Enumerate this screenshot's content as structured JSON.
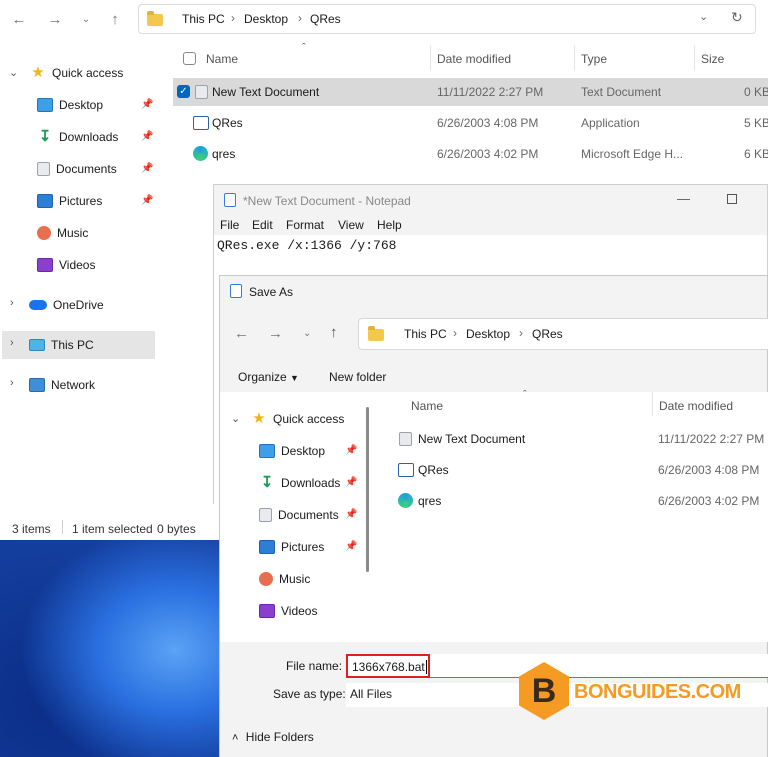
{
  "explorer": {
    "address": [
      "This PC",
      "Desktop",
      "QRes"
    ],
    "sidebar": [
      {
        "label": "Quick access",
        "icon": "star-icon"
      },
      {
        "label": "Desktop",
        "icon": "desktop-icon"
      },
      {
        "label": "Downloads",
        "icon": "downloads-icon"
      },
      {
        "label": "Documents",
        "icon": "documents-icon"
      },
      {
        "label": "Pictures",
        "icon": "pictures-icon"
      },
      {
        "label": "Music",
        "icon": "music-icon"
      },
      {
        "label": "Videos",
        "icon": "videos-icon"
      },
      {
        "label": "OneDrive",
        "icon": "onedrive-icon"
      },
      {
        "label": "This PC",
        "icon": "this-pc-icon"
      },
      {
        "label": "Network",
        "icon": "network-icon"
      }
    ],
    "columns": {
      "name": "Name",
      "date": "Date modified",
      "type": "Type",
      "size": "Size"
    },
    "files": [
      {
        "name": "New Text Document",
        "date": "11/11/2022 2:27 PM",
        "type": "Text Document",
        "size": "0 KB",
        "selected": true
      },
      {
        "name": "QRes",
        "date": "6/26/2003 4:08 PM",
        "type": "Application",
        "size": "5 KB"
      },
      {
        "name": "qres",
        "date": "6/26/2003 4:02 PM",
        "type": "Microsoft Edge H...",
        "size": "6 KB"
      }
    ],
    "status": {
      "items": "3 items",
      "selected": "1 item selected",
      "bytes": "0 bytes"
    }
  },
  "notepad": {
    "title": "*New Text Document - Notepad",
    "menu": [
      "File",
      "Edit",
      "Format",
      "View",
      "Help"
    ],
    "content": "QRes.exe /x:1366 /y:768"
  },
  "save_as": {
    "title": "Save As",
    "address": [
      "This PC",
      "Desktop",
      "QRes"
    ],
    "organize": "Organize",
    "new_folder": "New folder",
    "sidebar": [
      {
        "label": "Quick access"
      },
      {
        "label": "Desktop"
      },
      {
        "label": "Downloads"
      },
      {
        "label": "Documents"
      },
      {
        "label": "Pictures"
      },
      {
        "label": "Music"
      },
      {
        "label": "Videos"
      }
    ],
    "columns": {
      "name": "Name",
      "date": "Date modified"
    },
    "files": [
      {
        "name": "New Text Document",
        "date": "11/11/2022 2:27 PM"
      },
      {
        "name": "QRes",
        "date": "6/26/2003 4:08 PM"
      },
      {
        "name": "qres",
        "date": "6/26/2003 4:02 PM"
      }
    ],
    "file_name_label": "File name:",
    "file_name_value": "1366x768.bat",
    "save_type_label": "Save as type:",
    "save_type_value": "All Files",
    "hide_folders": "Hide Folders"
  },
  "watermark": {
    "letter": "B",
    "text": "BONGUIDES.COM"
  },
  "colors": {
    "accent": "#0067c0",
    "highlight_box": "#e02020",
    "watermark": "#f59a23"
  }
}
